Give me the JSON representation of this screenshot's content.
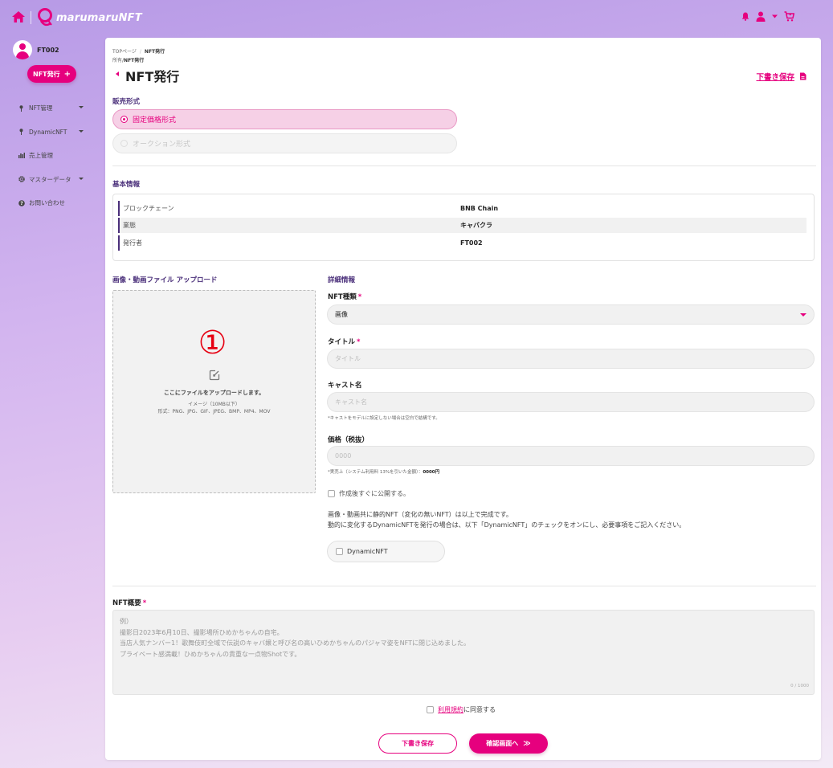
{
  "brand": {
    "logo_text": "marumaruNFT",
    "accent": "#e6007e",
    "purple": "#4a2f7a"
  },
  "sidebar": {
    "user_name": "FT002",
    "issue_button": "NFT発行",
    "items": [
      {
        "label": "NFT管理",
        "icon": "pin-icon",
        "has_caret": true
      },
      {
        "label": "DynamicNFT",
        "icon": "pin-icon",
        "has_caret": true
      },
      {
        "label": "売上管理",
        "icon": "bar-chart-icon",
        "has_caret": false
      },
      {
        "label": "マスターデータ",
        "icon": "gear-icon",
        "has_caret": true
      },
      {
        "label": "お問い合わせ",
        "icon": "help-icon",
        "has_caret": false
      }
    ]
  },
  "breadcrumb": {
    "home": "TOPページ",
    "current": "NFT発行",
    "sub_parent": "所有",
    "sub_current": "NFT発行"
  },
  "page_title": "NFT発行",
  "draft_link": "下書き保存",
  "sale_format": {
    "label": "販売形式",
    "options": [
      {
        "label": "固定価格形式",
        "selected": true
      },
      {
        "label": "オークション形式",
        "selected": false
      }
    ]
  },
  "basic_info": {
    "label": "基本情報",
    "rows": [
      {
        "key": "ブロックチェーン",
        "value": "BNB Chain"
      },
      {
        "key": "業態",
        "value": "キャバクラ"
      },
      {
        "key": "発行者",
        "value": "FT002"
      }
    ]
  },
  "upload": {
    "label": "画像・動画ファイル アップロード",
    "annotation": "①",
    "text": "ここにファイルをアップロードします。",
    "hint_size": "イメージ（10MB以下）",
    "hint_formats": "形式：PNG、JPG、GIF、JPEG、BMP、MP4、MOV"
  },
  "details": {
    "label": "詳細情報",
    "nft_type": {
      "label": "NFT種類",
      "value": "画像"
    },
    "title": {
      "label": "タイトル",
      "placeholder": "タイトル"
    },
    "cast": {
      "label": "キャスト名",
      "placeholder": "キャスト名",
      "note": "*キャストをモデルに設定しない場合は空白で結構です。"
    },
    "price": {
      "label": "価格（税抜）",
      "placeholder": "0000",
      "note_prefix": "*実売上（システム利用料 13%を引いた金額）：",
      "note_value": "0000円"
    },
    "publish_checkbox": "作成後すぐに公開する。",
    "desc_line1": "画像・動画共に静的NFT（変化の無いNFT）は以上で完成です。",
    "desc_line2": "動的に変化するDynamicNFTを発行の場合は、以下「DynamicNFT」のチェックをオンにし、必要事項をご記入ください。",
    "dynamic_checkbox": "DynamicNFT"
  },
  "overview": {
    "label": "NFT概要",
    "placeholder_lines": [
      "例）",
      "撮影日2023年6月10日、撮影場所ひめかちゃんの自宅。",
      "当店人気ナンバー1！歌舞伎町全域で伝説のキャバ嬢と呼び名の高いひめかちゃんのパジャマ姿をNFTに閉じ込めました。",
      "プライベート感満載！ひめかちゃんの貴重な一点物Shotです。"
    ],
    "count": "0 / 1000"
  },
  "agree": {
    "link": "利用規約",
    "text": "に同意する"
  },
  "buttons": {
    "draft": "下書き保存",
    "confirm": "確認画面へ"
  }
}
